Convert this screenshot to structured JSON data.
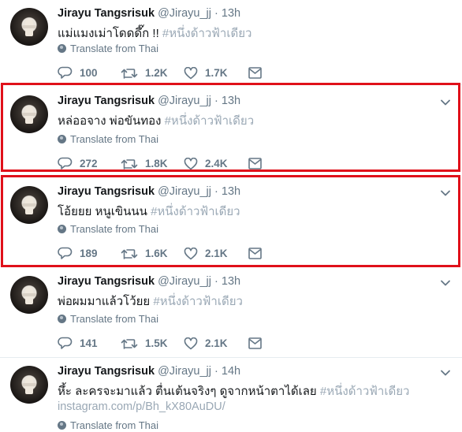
{
  "tweets": [
    {
      "name": "Jirayu Tangsrisuk",
      "handle": "@Jirayu_jj",
      "time": "13h",
      "text": "แม่แมงเม่าโดดดึ๊ก !! ",
      "hashtag": "#หนึ่งด้าวฟ้าเดียว",
      "translate": "Translate from Thai",
      "replies": "100",
      "retweets": "1.2K",
      "likes": "1.7K",
      "highlighted": false
    },
    {
      "name": "Jirayu Tangsrisuk",
      "handle": "@Jirayu_jj",
      "time": "13h",
      "text": "หล่ออจาง พ่อขันทอง ",
      "hashtag": "#หนึ่งด้าวฟ้าเดียว",
      "translate": "Translate from Thai",
      "replies": "272",
      "retweets": "1.8K",
      "likes": "2.4K",
      "highlighted": true
    },
    {
      "name": "Jirayu Tangsrisuk",
      "handle": "@Jirayu_jj",
      "time": "13h",
      "text": "โอ้ยยย หนูเขินนน ",
      "hashtag": "#หนึ่งด้าวฟ้าเดียว",
      "translate": "Translate from Thai",
      "replies": "189",
      "retweets": "1.6K",
      "likes": "2.1K",
      "highlighted": true
    },
    {
      "name": "Jirayu Tangsrisuk",
      "handle": "@Jirayu_jj",
      "time": "13h",
      "text": "พ่อผมมาแล้วโว้ยย ",
      "hashtag": "#หนึ่งด้าวฟ้าเดียว",
      "translate": "Translate from Thai",
      "replies": "141",
      "retweets": "1.5K",
      "likes": "2.1K",
      "highlighted": false
    },
    {
      "name": "Jirayu Tangsrisuk",
      "handle": "@Jirayu_jj",
      "time": "14h",
      "text": "หึ้ะ ละครจะมาแล้ว ตื่นเต้นจริงๆ ดูจากหน้าตาได้เลย ",
      "hashtag": "#หนึ่งด้าวฟ้าเดียว",
      "link": "instagram.com/p/Bh_kX80AuDU/",
      "translate": "Translate from Thai",
      "highlighted": false
    }
  ],
  "colors": {
    "highlight": "#e0101a",
    "secondary": "#657786",
    "hashtag": "#9aa8b5"
  },
  "icons": [
    "caret-down-icon",
    "globe-icon",
    "reply-icon",
    "retweet-icon",
    "like-icon",
    "direct-message-icon"
  ]
}
